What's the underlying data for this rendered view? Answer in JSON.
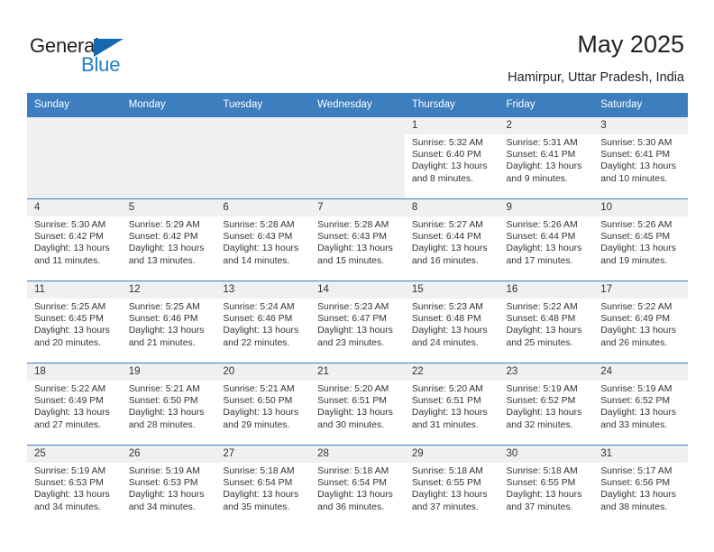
{
  "brand": {
    "name_part1": "General",
    "name_part2": "Blue",
    "triangle_icon": "triangle-icon",
    "color_dark": "#231f20",
    "color_blue": "#1e80c6"
  },
  "header": {
    "title": "May 2025",
    "subtitle": "Hamirpur, Uttar Pradesh, India"
  },
  "theme": {
    "header_bg": "#3d7ebf",
    "daynum_bg": "#f0f0f0",
    "cell_bg": "#ffffff",
    "text": "#333333"
  },
  "calendar": {
    "weekday_headers": [
      "Sunday",
      "Monday",
      "Tuesday",
      "Wednesday",
      "Thursday",
      "Friday",
      "Saturday"
    ],
    "labels": {
      "sunrise": "Sunrise:",
      "sunset": "Sunset:",
      "daylight": "Daylight:"
    },
    "weeks": [
      [
        {
          "empty": true
        },
        {
          "empty": true
        },
        {
          "empty": true
        },
        {
          "empty": true
        },
        {
          "day": "1",
          "sunrise": "Sunrise: 5:32 AM",
          "sunset": "Sunset: 6:40 PM",
          "daylight_line1": "Daylight: 13 hours",
          "daylight_line2": "and 8 minutes."
        },
        {
          "day": "2",
          "sunrise": "Sunrise: 5:31 AM",
          "sunset": "Sunset: 6:41 PM",
          "daylight_line1": "Daylight: 13 hours",
          "daylight_line2": "and 9 minutes."
        },
        {
          "day": "3",
          "sunrise": "Sunrise: 5:30 AM",
          "sunset": "Sunset: 6:41 PM",
          "daylight_line1": "Daylight: 13 hours",
          "daylight_line2": "and 10 minutes."
        }
      ],
      [
        {
          "day": "4",
          "sunrise": "Sunrise: 5:30 AM",
          "sunset": "Sunset: 6:42 PM",
          "daylight_line1": "Daylight: 13 hours",
          "daylight_line2": "and 11 minutes."
        },
        {
          "day": "5",
          "sunrise": "Sunrise: 5:29 AM",
          "sunset": "Sunset: 6:42 PM",
          "daylight_line1": "Daylight: 13 hours",
          "daylight_line2": "and 13 minutes."
        },
        {
          "day": "6",
          "sunrise": "Sunrise: 5:28 AM",
          "sunset": "Sunset: 6:43 PM",
          "daylight_line1": "Daylight: 13 hours",
          "daylight_line2": "and 14 minutes."
        },
        {
          "day": "7",
          "sunrise": "Sunrise: 5:28 AM",
          "sunset": "Sunset: 6:43 PM",
          "daylight_line1": "Daylight: 13 hours",
          "daylight_line2": "and 15 minutes."
        },
        {
          "day": "8",
          "sunrise": "Sunrise: 5:27 AM",
          "sunset": "Sunset: 6:44 PM",
          "daylight_line1": "Daylight: 13 hours",
          "daylight_line2": "and 16 minutes."
        },
        {
          "day": "9",
          "sunrise": "Sunrise: 5:26 AM",
          "sunset": "Sunset: 6:44 PM",
          "daylight_line1": "Daylight: 13 hours",
          "daylight_line2": "and 17 minutes."
        },
        {
          "day": "10",
          "sunrise": "Sunrise: 5:26 AM",
          "sunset": "Sunset: 6:45 PM",
          "daylight_line1": "Daylight: 13 hours",
          "daylight_line2": "and 19 minutes."
        }
      ],
      [
        {
          "day": "11",
          "sunrise": "Sunrise: 5:25 AM",
          "sunset": "Sunset: 6:45 PM",
          "daylight_line1": "Daylight: 13 hours",
          "daylight_line2": "and 20 minutes."
        },
        {
          "day": "12",
          "sunrise": "Sunrise: 5:25 AM",
          "sunset": "Sunset: 6:46 PM",
          "daylight_line1": "Daylight: 13 hours",
          "daylight_line2": "and 21 minutes."
        },
        {
          "day": "13",
          "sunrise": "Sunrise: 5:24 AM",
          "sunset": "Sunset: 6:46 PM",
          "daylight_line1": "Daylight: 13 hours",
          "daylight_line2": "and 22 minutes."
        },
        {
          "day": "14",
          "sunrise": "Sunrise: 5:23 AM",
          "sunset": "Sunset: 6:47 PM",
          "daylight_line1": "Daylight: 13 hours",
          "daylight_line2": "and 23 minutes."
        },
        {
          "day": "15",
          "sunrise": "Sunrise: 5:23 AM",
          "sunset": "Sunset: 6:48 PM",
          "daylight_line1": "Daylight: 13 hours",
          "daylight_line2": "and 24 minutes."
        },
        {
          "day": "16",
          "sunrise": "Sunrise: 5:22 AM",
          "sunset": "Sunset: 6:48 PM",
          "daylight_line1": "Daylight: 13 hours",
          "daylight_line2": "and 25 minutes."
        },
        {
          "day": "17",
          "sunrise": "Sunrise: 5:22 AM",
          "sunset": "Sunset: 6:49 PM",
          "daylight_line1": "Daylight: 13 hours",
          "daylight_line2": "and 26 minutes."
        }
      ],
      [
        {
          "day": "18",
          "sunrise": "Sunrise: 5:22 AM",
          "sunset": "Sunset: 6:49 PM",
          "daylight_line1": "Daylight: 13 hours",
          "daylight_line2": "and 27 minutes."
        },
        {
          "day": "19",
          "sunrise": "Sunrise: 5:21 AM",
          "sunset": "Sunset: 6:50 PM",
          "daylight_line1": "Daylight: 13 hours",
          "daylight_line2": "and 28 minutes."
        },
        {
          "day": "20",
          "sunrise": "Sunrise: 5:21 AM",
          "sunset": "Sunset: 6:50 PM",
          "daylight_line1": "Daylight: 13 hours",
          "daylight_line2": "and 29 minutes."
        },
        {
          "day": "21",
          "sunrise": "Sunrise: 5:20 AM",
          "sunset": "Sunset: 6:51 PM",
          "daylight_line1": "Daylight: 13 hours",
          "daylight_line2": "and 30 minutes."
        },
        {
          "day": "22",
          "sunrise": "Sunrise: 5:20 AM",
          "sunset": "Sunset: 6:51 PM",
          "daylight_line1": "Daylight: 13 hours",
          "daylight_line2": "and 31 minutes."
        },
        {
          "day": "23",
          "sunrise": "Sunrise: 5:19 AM",
          "sunset": "Sunset: 6:52 PM",
          "daylight_line1": "Daylight: 13 hours",
          "daylight_line2": "and 32 minutes."
        },
        {
          "day": "24",
          "sunrise": "Sunrise: 5:19 AM",
          "sunset": "Sunset: 6:52 PM",
          "daylight_line1": "Daylight: 13 hours",
          "daylight_line2": "and 33 minutes."
        }
      ],
      [
        {
          "day": "25",
          "sunrise": "Sunrise: 5:19 AM",
          "sunset": "Sunset: 6:53 PM",
          "daylight_line1": "Daylight: 13 hours",
          "daylight_line2": "and 34 minutes."
        },
        {
          "day": "26",
          "sunrise": "Sunrise: 5:19 AM",
          "sunset": "Sunset: 6:53 PM",
          "daylight_line1": "Daylight: 13 hours",
          "daylight_line2": "and 34 minutes."
        },
        {
          "day": "27",
          "sunrise": "Sunrise: 5:18 AM",
          "sunset": "Sunset: 6:54 PM",
          "daylight_line1": "Daylight: 13 hours",
          "daylight_line2": "and 35 minutes."
        },
        {
          "day": "28",
          "sunrise": "Sunrise: 5:18 AM",
          "sunset": "Sunset: 6:54 PM",
          "daylight_line1": "Daylight: 13 hours",
          "daylight_line2": "and 36 minutes."
        },
        {
          "day": "29",
          "sunrise": "Sunrise: 5:18 AM",
          "sunset": "Sunset: 6:55 PM",
          "daylight_line1": "Daylight: 13 hours",
          "daylight_line2": "and 37 minutes."
        },
        {
          "day": "30",
          "sunrise": "Sunrise: 5:18 AM",
          "sunset": "Sunset: 6:55 PM",
          "daylight_line1": "Daylight: 13 hours",
          "daylight_line2": "and 37 minutes."
        },
        {
          "day": "31",
          "sunrise": "Sunrise: 5:17 AM",
          "sunset": "Sunset: 6:56 PM",
          "daylight_line1": "Daylight: 13 hours",
          "daylight_line2": "and 38 minutes."
        }
      ]
    ]
  }
}
